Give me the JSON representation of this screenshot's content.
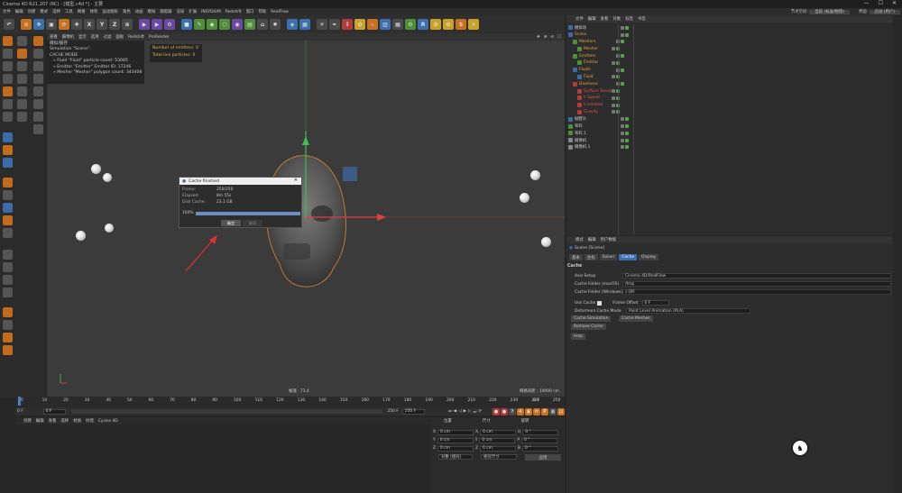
{
  "window": {
    "title": "Cinema 4D R21.207 (RC) - [模型.c4d *] - 主要"
  },
  "menubar": {
    "items": [
      "文件",
      "编辑",
      "创建",
      "模式",
      "选择",
      "工具",
      "网格",
      "体积",
      "运动图形",
      "角色",
      "动画",
      "模拟",
      "跟踪器",
      "渲染",
      "扩展",
      "INSYDIUM",
      "Redshift",
      "窗口",
      "帮助",
      "RealFlow"
    ],
    "node_space_label": "节点空间:",
    "node_space_value": "当前 (标准/物理)",
    "layout_label": "界面:",
    "layout_value": "启动 (用户)"
  },
  "toolbar": {
    "buttons": [
      {
        "icon": "undo-icon",
        "glyph": "↶",
        "color": ""
      },
      {
        "icon": "sep",
        "glyph": "",
        "color": "s"
      },
      {
        "icon": "live-select-icon",
        "glyph": "⊙",
        "color": "o"
      },
      {
        "icon": "move-icon",
        "glyph": "✥",
        "color": "b"
      },
      {
        "icon": "scale-icon",
        "glyph": "▣",
        "color": ""
      },
      {
        "icon": "rotate-icon",
        "glyph": "⟳",
        "color": "o"
      },
      {
        "icon": "recent-icon",
        "glyph": "✚",
        "color": ""
      },
      {
        "icon": "axis-x-icon",
        "glyph": "X",
        "color": ""
      },
      {
        "icon": "axis-y-icon",
        "glyph": "Y",
        "color": ""
      },
      {
        "icon": "axis-z-icon",
        "glyph": "Z",
        "color": ""
      },
      {
        "icon": "coord-system-icon",
        "glyph": "⊕",
        "color": ""
      },
      {
        "icon": "sep",
        "glyph": "",
        "color": "s"
      },
      {
        "icon": "render-view-icon",
        "glyph": "▶",
        "color": "p"
      },
      {
        "icon": "render-picture-icon",
        "glyph": "▶",
        "color": "p"
      },
      {
        "icon": "render-settings-icon",
        "glyph": "⚙",
        "color": "p"
      },
      {
        "icon": "sep",
        "glyph": "",
        "color": "s"
      },
      {
        "icon": "cube-icon",
        "glyph": "■",
        "color": "b"
      },
      {
        "icon": "pen-icon",
        "glyph": "✎",
        "color": "g"
      },
      {
        "icon": "subdivision-icon",
        "glyph": "◆",
        "color": "g"
      },
      {
        "icon": "cloner-icon",
        "glyph": "⬡",
        "color": "g"
      },
      {
        "icon": "deformer-icon",
        "glyph": "◉",
        "color": "p"
      },
      {
        "icon": "scene-icon",
        "glyph": "▤",
        "color": "g"
      },
      {
        "icon": "camera-icon",
        "glyph": "⌂",
        "color": ""
      },
      {
        "icon": "light-icon",
        "glyph": "✸",
        "color": ""
      },
      {
        "icon": "sep",
        "glyph": "",
        "color": "s"
      },
      {
        "icon": "tag-icon",
        "glyph": "◈",
        "color": "b"
      },
      {
        "icon": "grid-icon",
        "glyph": "▦",
        "color": "b"
      },
      {
        "icon": "sep",
        "glyph": "",
        "color": "s"
      },
      {
        "icon": "bulb-icon",
        "glyph": "☀",
        "color": ""
      },
      {
        "icon": "brush-icon",
        "glyph": "✒",
        "color": ""
      },
      {
        "icon": "arrow-icon",
        "glyph": "↧",
        "color": "r"
      },
      {
        "icon": "paint-icon",
        "glyph": "✿",
        "color": "y"
      },
      {
        "icon": "flame-icon",
        "glyph": "♨",
        "color": "o"
      },
      {
        "icon": "layers-icon",
        "glyph": "▥",
        "color": "b"
      },
      {
        "icon": "grid2-icon",
        "glyph": "▦",
        "color": ""
      },
      {
        "icon": "gear-icon",
        "glyph": "⚙",
        "color": "g"
      },
      {
        "icon": "redshift-icon",
        "glyph": "R",
        "color": "b"
      },
      {
        "icon": "plugin-icon",
        "glyph": "✿",
        "color": "y"
      },
      {
        "icon": "xparticles-icon",
        "glyph": "✿",
        "color": "y"
      },
      {
        "icon": "s-plugin-icon",
        "glyph": "S",
        "color": "o"
      },
      {
        "icon": "sun-icon",
        "glyph": "☀",
        "color": "y"
      }
    ]
  },
  "viewport": {
    "menu": [
      "查看",
      "摄像机",
      "显示",
      "选项",
      "过滤",
      "面板",
      "Redshift",
      "ProRender"
    ],
    "info": [
      "模拟/缓存",
      "Simulation \"Scene\":",
      "CACHE MODE",
      "» Fluid \"Fluid\" particle count: 53085",
      "» Emitter \"Emitter\" Emitter ID: 17246",
      "» Mesher \"Mesher\" polygon count: 343408"
    ],
    "emitters": [
      "Number of emitters: 0",
      "Total live particles: 0"
    ],
    "view_stat": "帧速 : 71.4",
    "grid_label": "网格间距 : 10000 cm"
  },
  "dialog": {
    "title": "Cache finished",
    "rows": [
      {
        "k": "Frame:",
        "v": "250/250"
      },
      {
        "k": "Elapsed:",
        "v": "8m 55s"
      },
      {
        "k": "Disk Cache:",
        "v": "23.1 GB"
      }
    ],
    "progress_label": "100%",
    "progress": 1.0,
    "ok_label": "确定",
    "cancel_label": "取消"
  },
  "timeline": {
    "ticks": [
      "0",
      "10",
      "20",
      "30",
      "40",
      "50",
      "60",
      "70",
      "80",
      "90",
      "100",
      "110",
      "120",
      "130",
      "140",
      "150",
      "160",
      "170",
      "180",
      "190",
      "200",
      "210",
      "220",
      "230",
      "240",
      "250"
    ],
    "current_frame": "0 F",
    "start": "0 F",
    "start2": "0 F",
    "end": "250 F",
    "end2": "250 F"
  },
  "bottom": {
    "menu": [
      "创建",
      "编辑",
      "查看",
      "选择",
      "材质",
      "纹理",
      "Cycles 4D"
    ]
  },
  "coords": {
    "headers": [
      "位置",
      "尺寸",
      "旋转"
    ],
    "rows": [
      {
        "axis": "X",
        "pos": "0 cm",
        "size": "0 cm",
        "rot_axis": "H",
        "rot": "0 °"
      },
      {
        "axis": "Y",
        "pos": "0 cm",
        "size": "0 cm",
        "rot_axis": "P",
        "rot": "0 °"
      },
      {
        "axis": "Z",
        "pos": "0 cm",
        "size": "0 cm",
        "rot_axis": "B",
        "rot": "0 °"
      }
    ],
    "mode1": "对象 (相对)",
    "mode2": "绝对尺寸",
    "apply": "应用"
  },
  "objects": {
    "menu": [
      "文件",
      "编辑",
      "查看",
      "对象",
      "标签",
      "书签"
    ],
    "rows": [
      {
        "name": "模拟场",
        "indent": 0,
        "style": "",
        "icon": "#3d6aa8"
      },
      {
        "name": "Scene",
        "indent": 0,
        "style": "sel",
        "icon": "#3d6aa8"
      },
      {
        "name": "Meshers",
        "indent": 1,
        "style": "sel",
        "icon": "#4f8f3a"
      },
      {
        "name": "Mesher",
        "indent": 2,
        "style": "sel",
        "icon": "#4f8f3a"
      },
      {
        "name": "Emitters",
        "indent": 1,
        "style": "sel",
        "icon": "#4f8f3a"
      },
      {
        "name": "Emitter",
        "indent": 2,
        "style": "sel",
        "icon": "#4f8f3a"
      },
      {
        "name": "Fluids",
        "indent": 1,
        "style": "sel",
        "icon": "#3d6aa8"
      },
      {
        "name": "Fluid",
        "indent": 2,
        "style": "sel",
        "icon": "#3d6aa8"
      },
      {
        "name": "Daemons",
        "indent": 1,
        "style": "sel",
        "icon": "#b23c3c"
      },
      {
        "name": "Surface Tension",
        "indent": 2,
        "style": "red",
        "icon": "#b23c3c"
      },
      {
        "name": "k Speed",
        "indent": 2,
        "style": "red",
        "icon": "#b23c3c"
      },
      {
        "name": "k Isolated",
        "indent": 2,
        "style": "red",
        "icon": "#b23c3c"
      },
      {
        "name": "Gravity",
        "indent": 2,
        "style": "red",
        "icon": "#b23c3c"
      },
      {
        "name": "骷髅头",
        "indent": 0,
        "style": "",
        "icon": "#3d6aa8"
      },
      {
        "name": "布料",
        "indent": 0,
        "style": "",
        "icon": "#4f8f3a"
      },
      {
        "name": "布料.1",
        "indent": 0,
        "style": "",
        "icon": "#4f8f3a"
      },
      {
        "name": "摄像机",
        "indent": 0,
        "style": "",
        "icon": "#888"
      },
      {
        "name": "摄像机.1",
        "indent": 0,
        "style": "",
        "icon": "#888"
      }
    ]
  },
  "attributes": {
    "menu": [
      "模式",
      "编辑",
      "用户数据"
    ],
    "object_name": "Scene [Scene]",
    "tabs": [
      "基本",
      "坐标",
      "Solver",
      "Cache",
      "Display"
    ],
    "active_tab": 3,
    "section": "Cache",
    "fields": [
      {
        "label": "Axis Setup",
        "value": "Cinema 4D/RealFlow"
      },
      {
        "label": "Cache Folder (macOS)",
        "value": "/tmp"
      },
      {
        "label": "Cache Folder (Windows)",
        "value": "c:\\RF"
      }
    ],
    "use_cache_label": "Use Cache",
    "frame_offset_label": "Frame Offset",
    "frame_offset_value": "0 F",
    "deformers_label": "Deformers Cache Mode",
    "deformers_value": "Point Level Animation (PLA)",
    "buttons": [
      "Cache Simulation",
      "Cache Meshes",
      "Remove Cache"
    ],
    "help": "Help"
  },
  "logo_glyph": "♞"
}
